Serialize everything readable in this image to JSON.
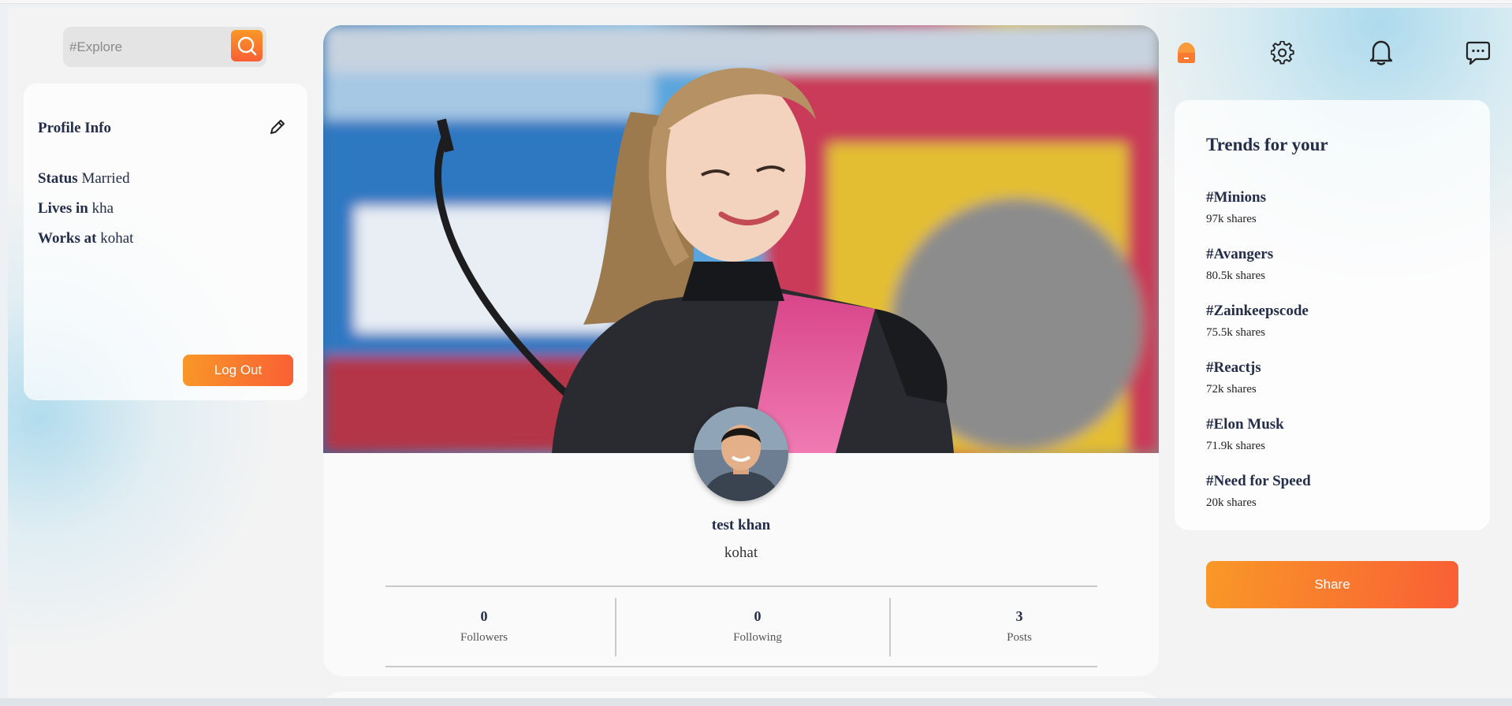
{
  "search": {
    "placeholder": "#Explore"
  },
  "profile_info": {
    "title": "Profile Info",
    "rows": [
      {
        "label": "Status",
        "value": "Married"
      },
      {
        "label": "Lives in",
        "value": "kha"
      },
      {
        "label": "Works at",
        "value": "kohat"
      }
    ],
    "logout_label": "Log Out"
  },
  "profile": {
    "name": "test khan",
    "location": "kohat",
    "stats": [
      {
        "value": "0",
        "label": "Followers"
      },
      {
        "value": "0",
        "label": "Following"
      },
      {
        "value": "3",
        "label": "Posts"
      }
    ]
  },
  "trends": {
    "title": "Trends for your",
    "items": [
      {
        "name": "#Minions",
        "shares": "97k shares"
      },
      {
        "name": "#Avangers",
        "shares": "80.5k shares"
      },
      {
        "name": "#Zainkeepscode",
        "shares": "75.5k shares"
      },
      {
        "name": "#Reactjs",
        "shares": "72k shares"
      },
      {
        "name": "#Elon Musk",
        "shares": "71.9k shares"
      },
      {
        "name": "#Need for Speed",
        "shares": "20k shares"
      }
    ]
  },
  "share_label": "Share",
  "nav_icons": [
    "home-icon",
    "gear-icon",
    "bell-icon",
    "chat-icon"
  ],
  "colors": {
    "accent_start": "#f99827",
    "accent_end": "#f95f35",
    "text": "#242d49"
  }
}
